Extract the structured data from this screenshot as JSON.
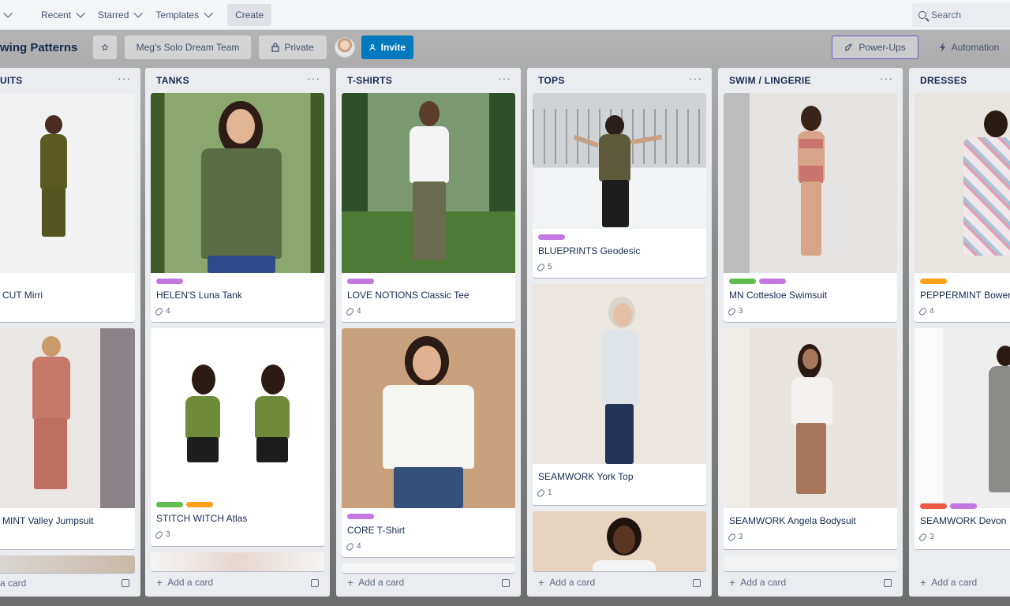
{
  "nav": {
    "recent": "Recent",
    "starred": "Starred",
    "templates": "Templates",
    "create": "Create",
    "search": "Search"
  },
  "board": {
    "title": "wing Patterns",
    "team": "Meg's Solo Dream Team",
    "visibility": "Private",
    "invite": "Invite",
    "powerups": "Power-Ups",
    "automation": "Automation"
  },
  "colors": {
    "blue": "#0079bf",
    "purple": "#c377e0",
    "green": "#61bd4f",
    "orange": "#ff9f1a",
    "red": "#eb5a46"
  },
  "lists": [
    {
      "name": "UITS",
      "add": "a card",
      "cards": [
        {
          "title": "CUT Mirri",
          "labels": [
            "blue"
          ],
          "attachments": ""
        },
        {
          "title": "MINT Valley Jumpsuit",
          "labels": [],
          "attachments": ""
        }
      ]
    },
    {
      "name": "TANKS",
      "add": "Add a card",
      "cards": [
        {
          "title": "HELEN'S Luna Tank",
          "labels": [
            "purple"
          ],
          "attachments": "4"
        },
        {
          "title": "STITCH WITCH Atlas",
          "labels": [
            "green",
            "orange"
          ],
          "attachments": "3"
        }
      ]
    },
    {
      "name": "T-SHIRTS",
      "add": "Add a card",
      "cards": [
        {
          "title": "LOVE NOTIONS Classic Tee",
          "labels": [
            "purple"
          ],
          "attachments": "4"
        },
        {
          "title": "CORE T-Shirt",
          "labels": [
            "purple"
          ],
          "attachments": "4"
        }
      ]
    },
    {
      "name": "TOPS",
      "add": "Add a card",
      "cards": [
        {
          "title": "BLUEPRINTS Geodesic",
          "labels": [
            "purple"
          ],
          "attachments": "5"
        },
        {
          "title": "SEAMWORK York Top",
          "labels": [],
          "attachments": "1"
        }
      ]
    },
    {
      "name": "SWIM / LINGERIE",
      "add": "Add a card",
      "cards": [
        {
          "title": "MN Cottesloe Swimsuit",
          "labels": [
            "green",
            "purple"
          ],
          "attachments": "3"
        },
        {
          "title": "SEAMWORK Angela Bodysuit",
          "labels": [],
          "attachments": "3"
        }
      ]
    },
    {
      "name": "DRESSES",
      "add": "Add a card",
      "cards": [
        {
          "title": "PEPPERMINT Bower",
          "labels": [
            "orange"
          ],
          "attachments": "4"
        },
        {
          "title": "SEAMWORK Devon",
          "labels": [
            "red",
            "purple"
          ],
          "attachments": "3"
        }
      ]
    }
  ],
  "menu_glyph": "···"
}
